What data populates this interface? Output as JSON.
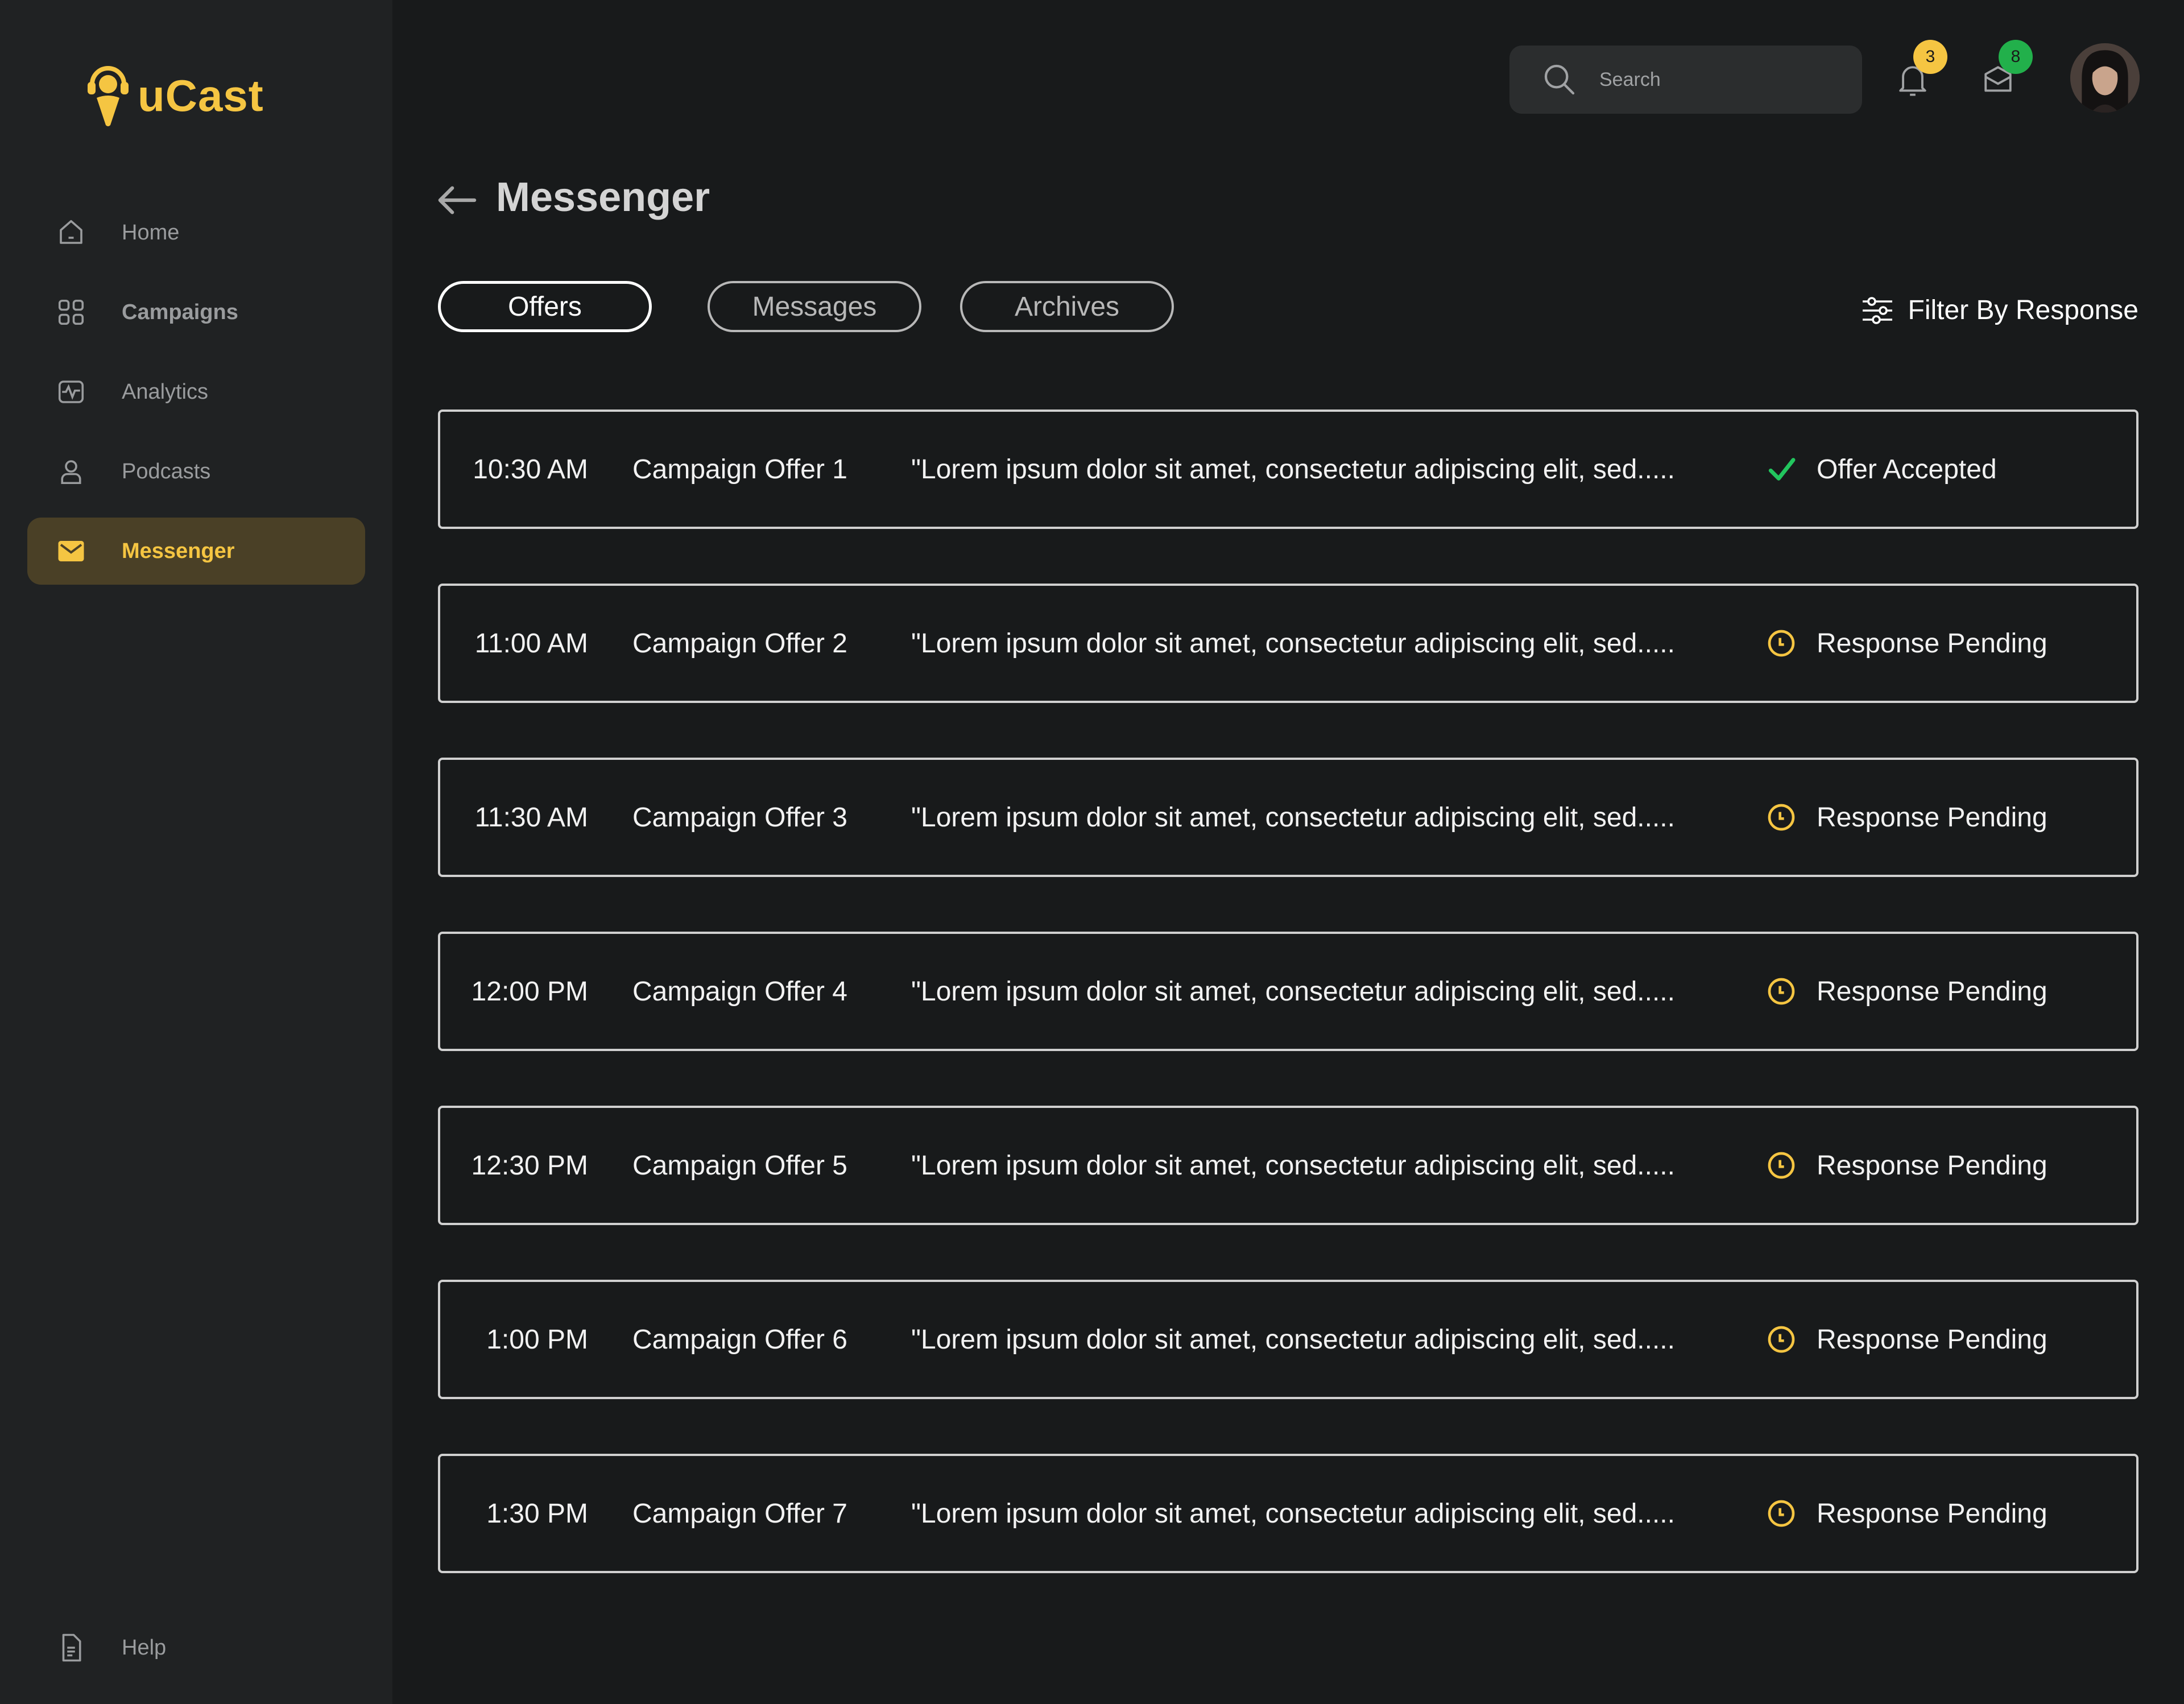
{
  "brand": {
    "name": "uCast",
    "accent": "#f5c542"
  },
  "sidebar": {
    "items": [
      {
        "label": "Home",
        "icon": "home-icon"
      },
      {
        "label": "Campaigns",
        "icon": "grid-icon"
      },
      {
        "label": "Analytics",
        "icon": "activity-icon"
      },
      {
        "label": "Podcasts",
        "icon": "user-icon"
      },
      {
        "label": "Messenger",
        "icon": "mail-icon",
        "active": true
      }
    ],
    "help": {
      "label": "Help",
      "icon": "document-icon"
    }
  },
  "topbar": {
    "search_placeholder": "Search",
    "notifications_count": "3",
    "notifications_badge_color": "#f5c542",
    "messages_count": "8",
    "messages_badge_color": "#22b04b"
  },
  "header": {
    "title": "Messenger"
  },
  "tabs": [
    {
      "label": "Offers",
      "active": true
    },
    {
      "label": "Messages"
    },
    {
      "label": "Archives"
    }
  ],
  "filter": {
    "label": "Filter By Response"
  },
  "offers": [
    {
      "time": "10:30 AM",
      "name": "Campaign Offer 1",
      "message": "\"Lorem ipsum dolor sit amet, consectetur adipiscing elit, sed.....",
      "status": "Offer Accepted",
      "status_icon": "check-icon"
    },
    {
      "time": "11:00 AM",
      "name": "Campaign Offer 2",
      "message": "\"Lorem ipsum dolor sit amet, consectetur adipiscing elit, sed.....",
      "status": "Response Pending",
      "status_icon": "clock-icon"
    },
    {
      "time": "11:30 AM",
      "name": "Campaign Offer 3",
      "message": "\"Lorem ipsum dolor sit amet, consectetur adipiscing elit, sed.....",
      "status": "Response Pending",
      "status_icon": "clock-icon"
    },
    {
      "time": "12:00 PM",
      "name": "Campaign Offer 4",
      "message": "\"Lorem ipsum dolor sit amet, consectetur adipiscing elit, sed.....",
      "status": "Response Pending",
      "status_icon": "clock-icon"
    },
    {
      "time": "12:30 PM",
      "name": "Campaign Offer 5",
      "message": "\"Lorem ipsum dolor sit amet, consectetur adipiscing elit, sed.....",
      "status": "Response Pending",
      "status_icon": "clock-icon"
    },
    {
      "time": "1:00 PM",
      "name": "Campaign Offer 6",
      "message": "\"Lorem ipsum dolor sit amet, consectetur adipiscing elit, sed.....",
      "status": "Response Pending",
      "status_icon": "clock-icon"
    },
    {
      "time": "1:30 PM",
      "name": "Campaign Offer 7",
      "message": "\"Lorem ipsum dolor sit amet, consectetur adipiscing elit, sed.....",
      "status": "Response Pending",
      "status_icon": "clock-icon"
    }
  ],
  "colors": {
    "accepted": "#22c55e",
    "pending": "#f5c542"
  }
}
